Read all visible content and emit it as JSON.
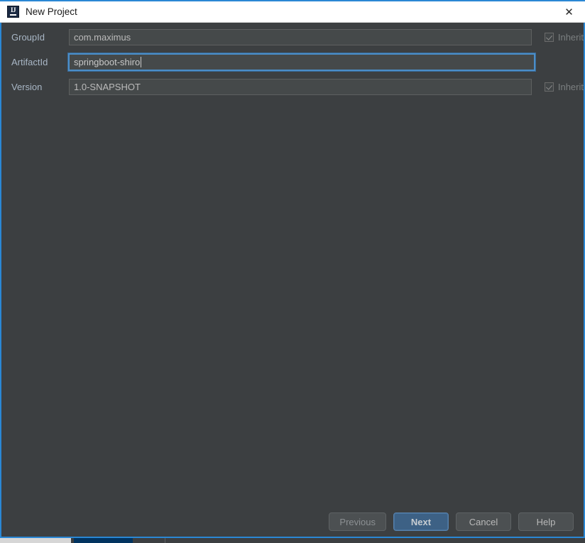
{
  "window": {
    "title": "New Project",
    "logo_icon": "intellij-idea-logo-icon",
    "close_icon": "close-icon",
    "close_glyph": "✕"
  },
  "form": {
    "rows": [
      {
        "label": "GroupId",
        "value": "com.maximus",
        "focused": false,
        "inherit": {
          "label": "Inherit",
          "checked": true,
          "enabled": false
        }
      },
      {
        "label": "ArtifactId",
        "value": "springboot-shiro",
        "focused": true,
        "inherit": null
      },
      {
        "label": "Version",
        "value": "1.0-SNAPSHOT",
        "focused": false,
        "inherit": {
          "label": "Inherit",
          "checked": true,
          "enabled": false
        }
      }
    ]
  },
  "footer": {
    "previous_label": "Previous",
    "next_label": "Next",
    "cancel_label": "Cancel",
    "help_label": "Help"
  },
  "colors": {
    "dialog_background": "#3c3f41",
    "dialog_border": "#2a87d4",
    "titlebar_background": "#ffffff",
    "label_text": "#a9b7c6",
    "input_background": "#45494a",
    "focus_border": "#4b8ec9",
    "primary_button": "#3d6185",
    "taskbar_navy": "#01335f",
    "taskbar_light": "#d6d6d6"
  }
}
